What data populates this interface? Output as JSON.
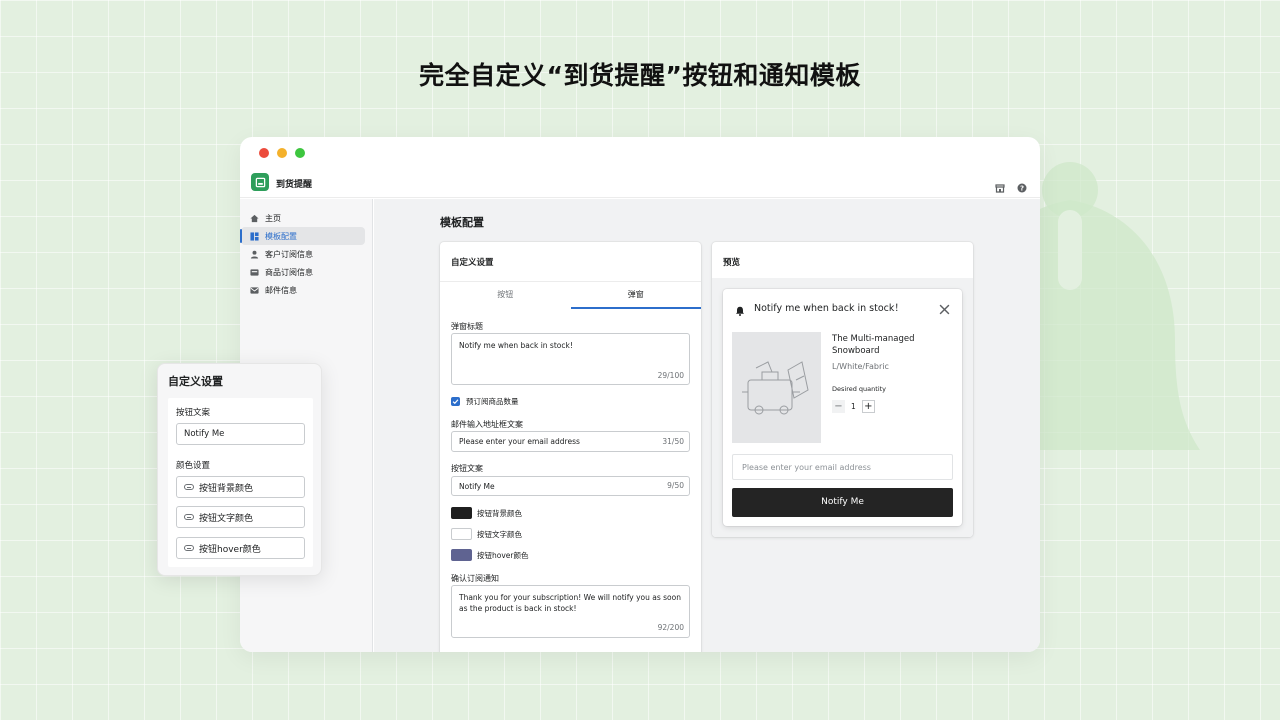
{
  "headline": "完全自定义“到货提醒”按钮和通知模板",
  "colors": {
    "accent": "#2c6ecb",
    "brand": "#2e9e5b",
    "dark_button": "#242424"
  },
  "app": {
    "name": "到货提醒",
    "icon": "app-logo-icon",
    "top_icons": [
      "store-icon",
      "help-icon"
    ]
  },
  "sidebar": {
    "items": [
      {
        "label": "主页",
        "icon": "home-icon"
      },
      {
        "label": "模板配置",
        "icon": "template-icon",
        "active": true
      },
      {
        "label": "客户订阅信息",
        "icon": "person-icon"
      },
      {
        "label": "商品订阅信息",
        "icon": "product-icon"
      },
      {
        "label": "邮件信息",
        "icon": "mail-icon"
      }
    ]
  },
  "page": {
    "title": "模板配置"
  },
  "settings": {
    "title": "自定义设置",
    "tabs": [
      {
        "label": "按钮"
      },
      {
        "label": "弹窗",
        "active": true
      }
    ],
    "popup_title_label": "弹窗标题",
    "popup_title_value": "Notify me when back in stock!",
    "popup_title_counter": "29/100",
    "show_quantity_label": "预订阅商品数量",
    "show_quantity_checked": true,
    "email_placeholder_label": "邮件输入地址框文案",
    "email_placeholder_value": "Please enter your email address",
    "email_placeholder_counter": "31/50",
    "button_text_label": "按钮文案",
    "button_text_value": "Notify Me",
    "button_text_counter": "9/50",
    "colors": [
      {
        "label": "按钮背景颜色",
        "value": "#1f1f1f"
      },
      {
        "label": "按钮文字颜色",
        "value": "#ffffff"
      },
      {
        "label": "按钮hover颜色",
        "value": "#5f6391"
      }
    ],
    "confirm_label": "确认订阅通知",
    "confirm_value": "Thank you for your subscription! We will notify you as soon as the product is back in stock!",
    "confirm_counter": "92/200"
  },
  "preview": {
    "title": "预览",
    "popup_title": "Notify me when back in stock！",
    "product_name": "The Multi-managed Snowboard",
    "variant": "L/White/Fabric",
    "quantity_label": "Desired quantity",
    "quantity": "1",
    "email_placeholder": "Please enter your email address",
    "button_label": "Notify Me"
  },
  "floating": {
    "title": "自定义设置",
    "button_text_label": "按钮文案",
    "button_text_value": "Notify Me",
    "color_label": "颜色设置",
    "color_buttons": [
      "按钮背景颜色",
      "按钮文字颜色",
      "按钮hover颜色"
    ]
  }
}
